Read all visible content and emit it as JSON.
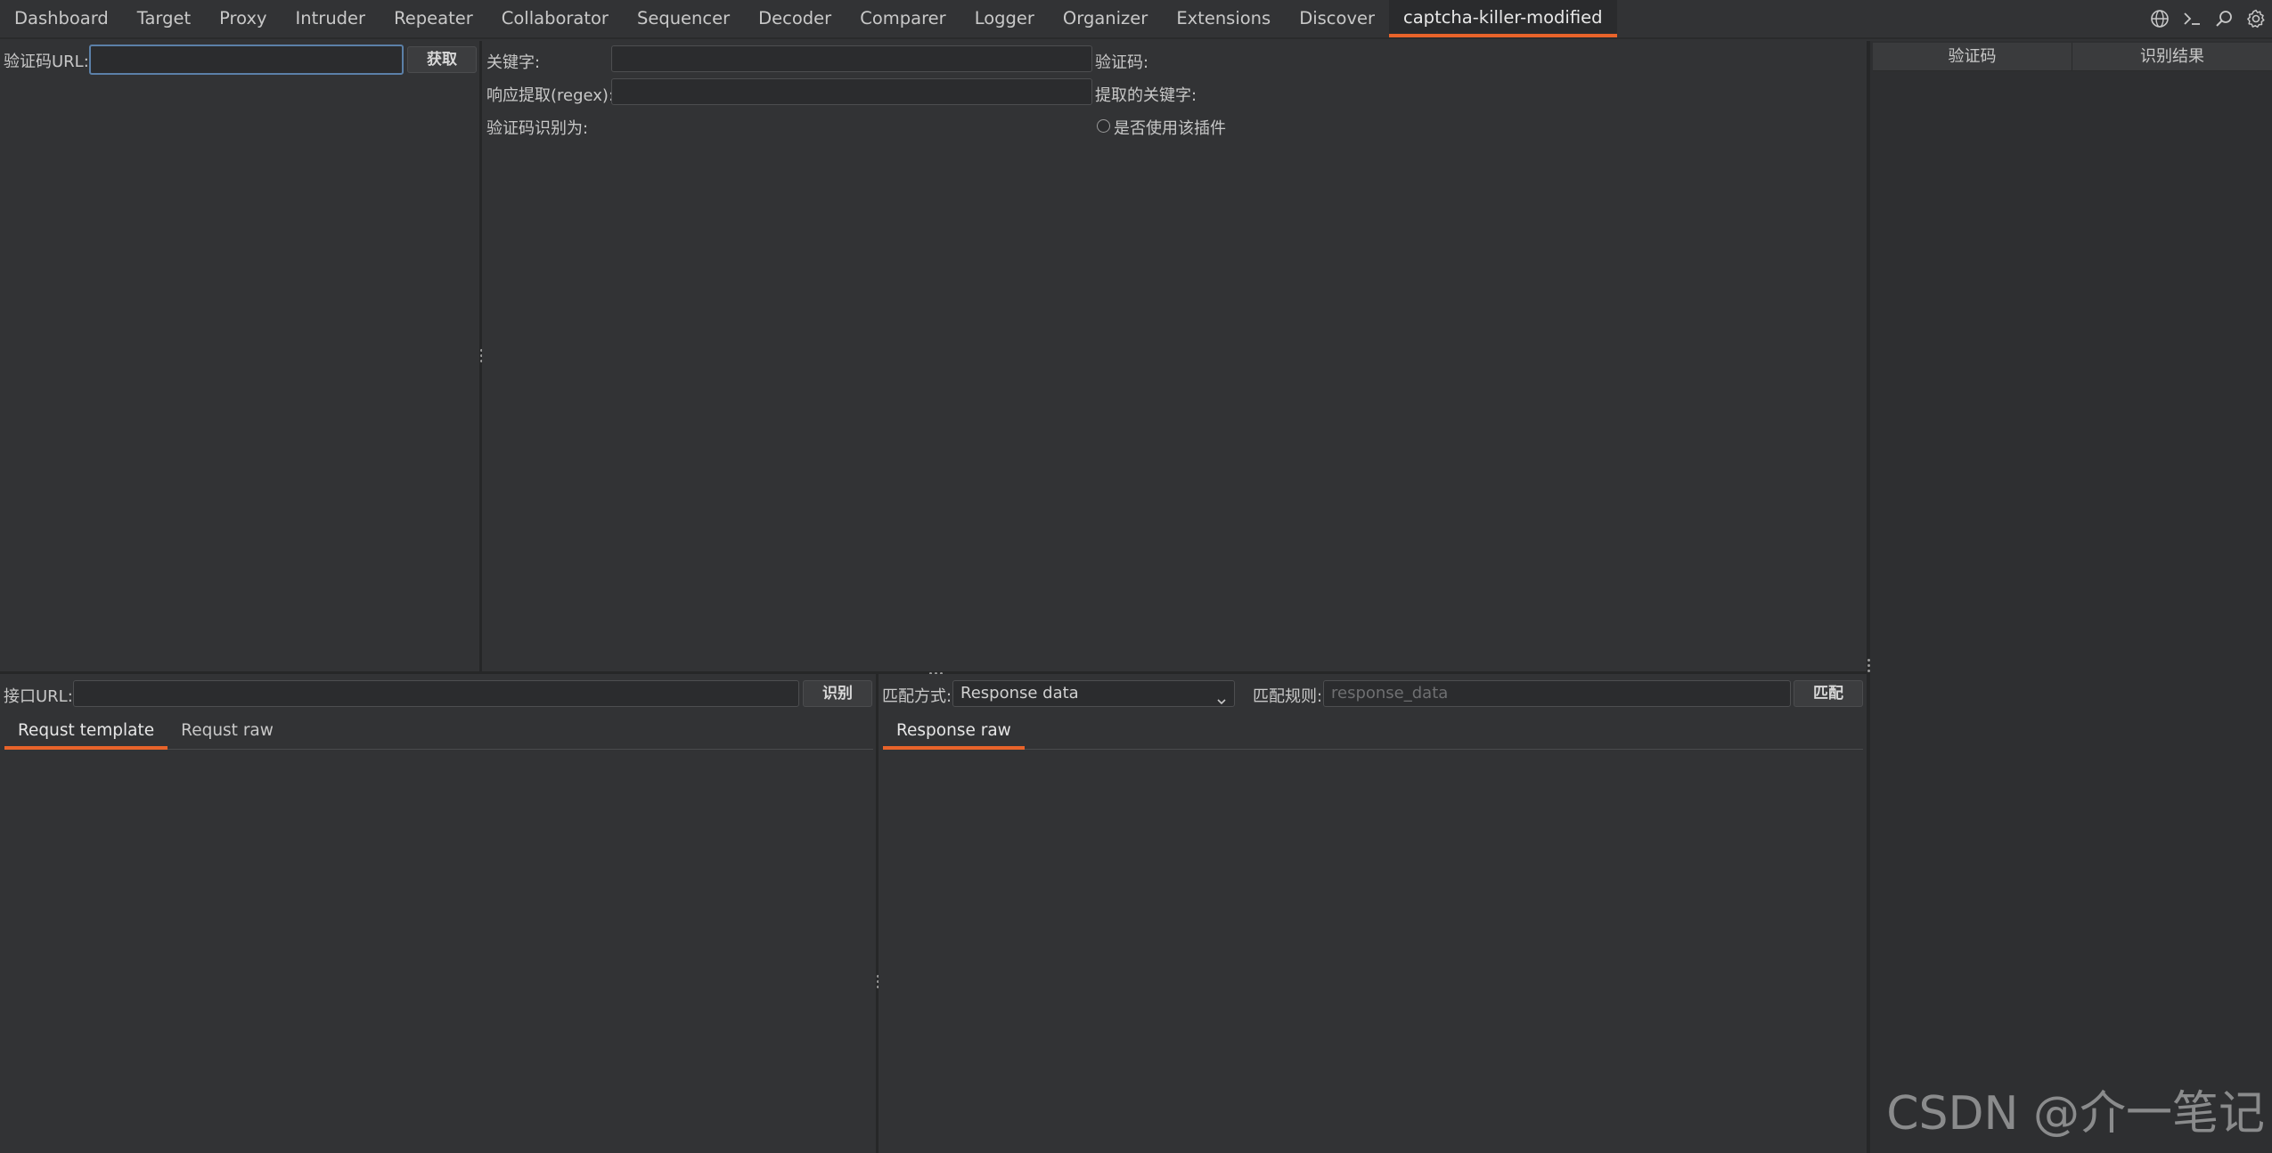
{
  "tabs": [
    {
      "label": "Dashboard",
      "active": false
    },
    {
      "label": "Target",
      "active": false
    },
    {
      "label": "Proxy",
      "active": false
    },
    {
      "label": "Intruder",
      "active": false
    },
    {
      "label": "Repeater",
      "active": false
    },
    {
      "label": "Collaborator",
      "active": false
    },
    {
      "label": "Sequencer",
      "active": false
    },
    {
      "label": "Decoder",
      "active": false
    },
    {
      "label": "Comparer",
      "active": false
    },
    {
      "label": "Logger",
      "active": false
    },
    {
      "label": "Organizer",
      "active": false
    },
    {
      "label": "Extensions",
      "active": false
    },
    {
      "label": "Discover",
      "active": false
    },
    {
      "label": "captcha-killer-modified",
      "active": true
    }
  ],
  "top_icons": [
    "globe-icon",
    "terminal-icon",
    "search-icon",
    "gear-icon"
  ],
  "captcha_panel": {
    "url_label": "验证码URL:",
    "url_value": "",
    "fetch_button": "获取"
  },
  "config_panel": {
    "keyword_label": "关键字:",
    "keyword_value": "",
    "regex_label": "响应提取(regex):",
    "regex_value": "",
    "recognized_label": "验证码识别为:",
    "captcha_label": "验证码:",
    "extracted_keyword_label": "提取的关键字:",
    "use_plugin_label": "是否使用该插件",
    "use_plugin_checked": false
  },
  "result_table": {
    "columns": [
      "验证码",
      "识别结果"
    ]
  },
  "request_panel": {
    "api_url_label": "接口URL:",
    "api_url_value": "",
    "recognize_button": "识别",
    "tabs": [
      {
        "label": "Requst template",
        "active": true
      },
      {
        "label": "Requst raw",
        "active": false
      }
    ]
  },
  "response_panel": {
    "match_mode_label": "匹配方式:",
    "match_mode_value": "Response data",
    "match_rule_label": "匹配规则:",
    "match_rule_placeholder": "response_data",
    "match_button": "匹配",
    "tabs": [
      {
        "label": "Response raw",
        "active": true
      }
    ]
  },
  "watermark": "CSDN @介一笔记",
  "colors": {
    "background": "#323335",
    "accent": "#e8632a",
    "focus_border": "#5b80a8"
  }
}
